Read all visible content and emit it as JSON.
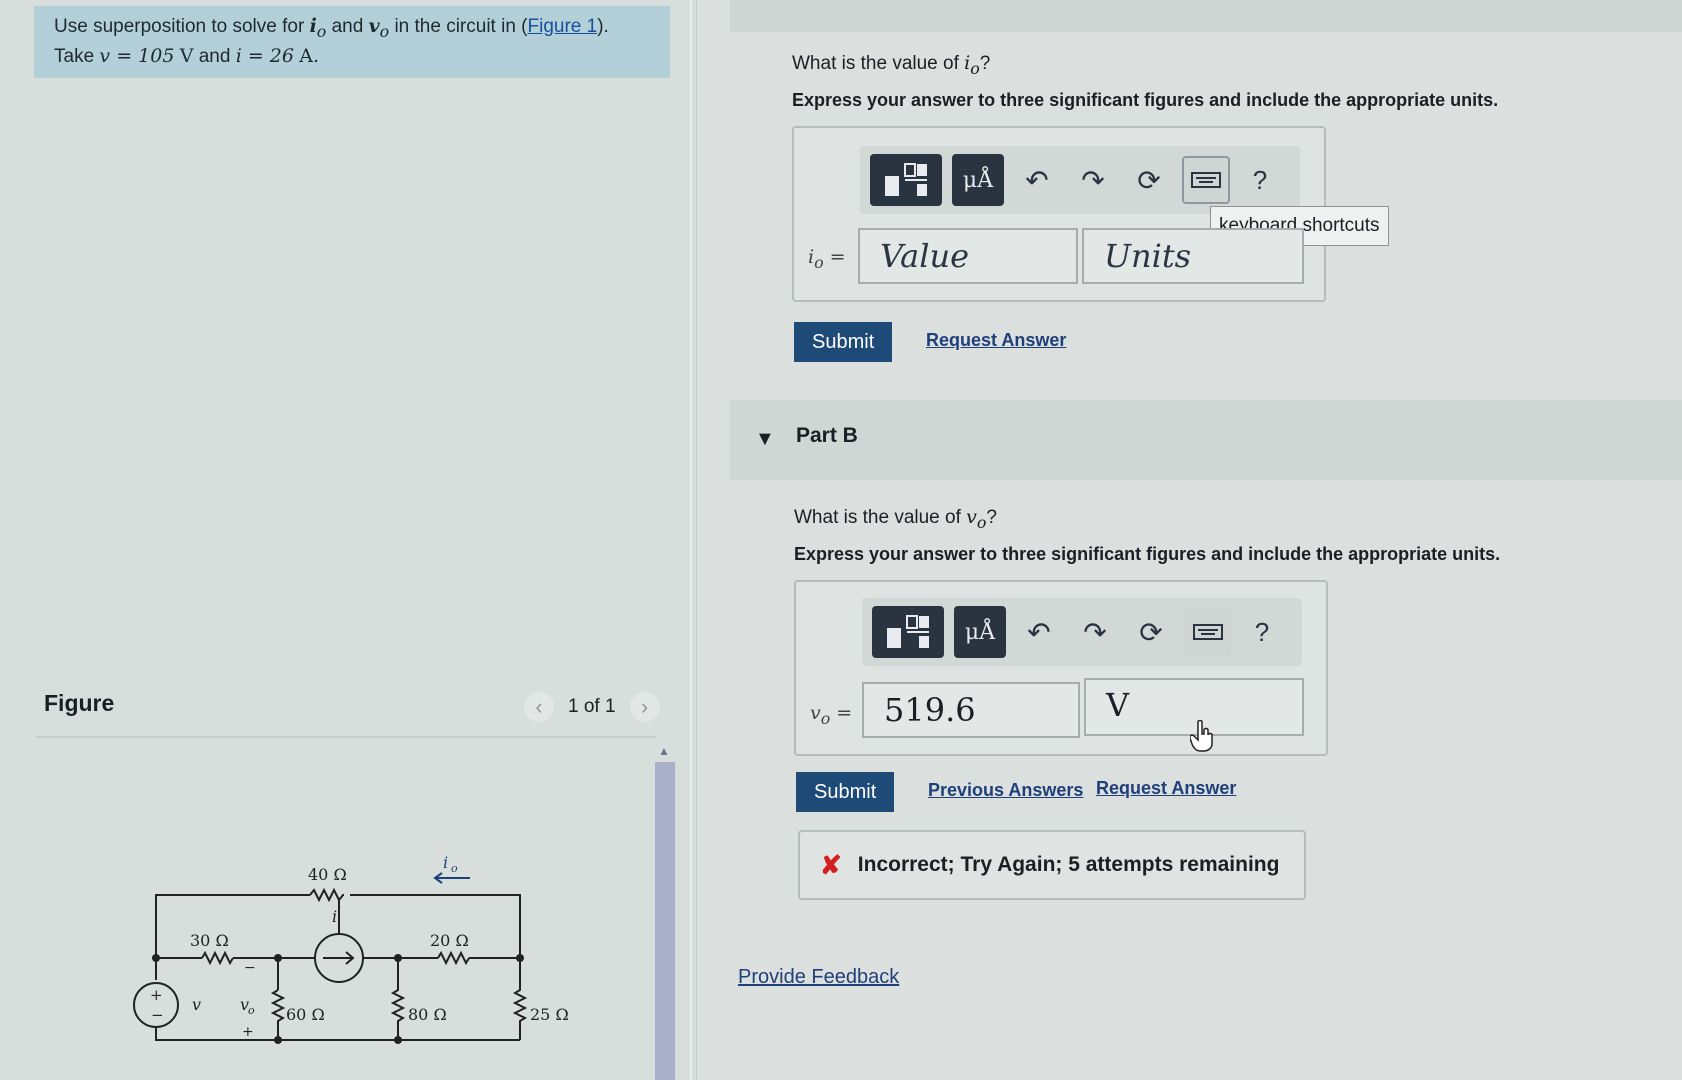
{
  "problem": {
    "line1_prefix": "Use superposition to solve for",
    "var_i": "i",
    "sub_o": "o",
    "and": "and",
    "var_v": "v",
    "line1_suffix": "in the circuit in (",
    "figure_link": "Figure 1",
    "close_paren": ").",
    "line2_prefix": "Take",
    "v_eq": "v = 105",
    "v_unit": "V",
    "and2": "and",
    "i_eq": "i = 26",
    "i_unit": "A."
  },
  "figure": {
    "label": "Figure",
    "pager_text": "1 of 1",
    "prev": "‹",
    "next": "›"
  },
  "circuit": {
    "r40": "40 Ω",
    "r30": "30 Ω",
    "r20": "20 Ω",
    "r60": "60 Ω",
    "r80": "80 Ω",
    "r25": "25 Ω",
    "io": "i",
    "io_sub": "o",
    "i_src": "i",
    "v_src": "v",
    "vo": "v",
    "vo_sub": "o",
    "plus": "+",
    "minus": "−"
  },
  "partA": {
    "question_prefix": "What is the value of",
    "question_var": "i",
    "question_sub": "o",
    "question_suffix": "?",
    "instruction": "Express your answer to three significant figures and include the appropriate units.",
    "field_label": "i",
    "field_sub": "o",
    "eq": " =",
    "value_placeholder": "Value",
    "units_placeholder": "Units",
    "tooltip": "keyboard shortcuts",
    "submit": "Submit",
    "request_answer": "Request Answer"
  },
  "toolbar": {
    "units_glyph": "μÅ",
    "help": "?"
  },
  "partB": {
    "title": "Part B",
    "question_prefix": "What is the value of",
    "question_var": "v",
    "question_sub": "o",
    "question_suffix": "?",
    "instruction": "Express your answer to three significant figures and include the appropriate units.",
    "field_label": "v",
    "field_sub": "o",
    "eq": " =",
    "value": "519.6",
    "units": "V",
    "submit": "Submit",
    "previous_answers": "Previous Answers",
    "request_answer": "Request Answer",
    "feedback": "Incorrect; Try Again; 5 attempts remaining",
    "feedback_icon": "✘"
  },
  "footer": {
    "provide_feedback": "Provide Feedback"
  },
  "colors": {
    "accent_dark": "#2a3340",
    "submit_bg": "#1e4a78",
    "error": "#d21f1f",
    "problem_bg": "#b3d0d8"
  }
}
